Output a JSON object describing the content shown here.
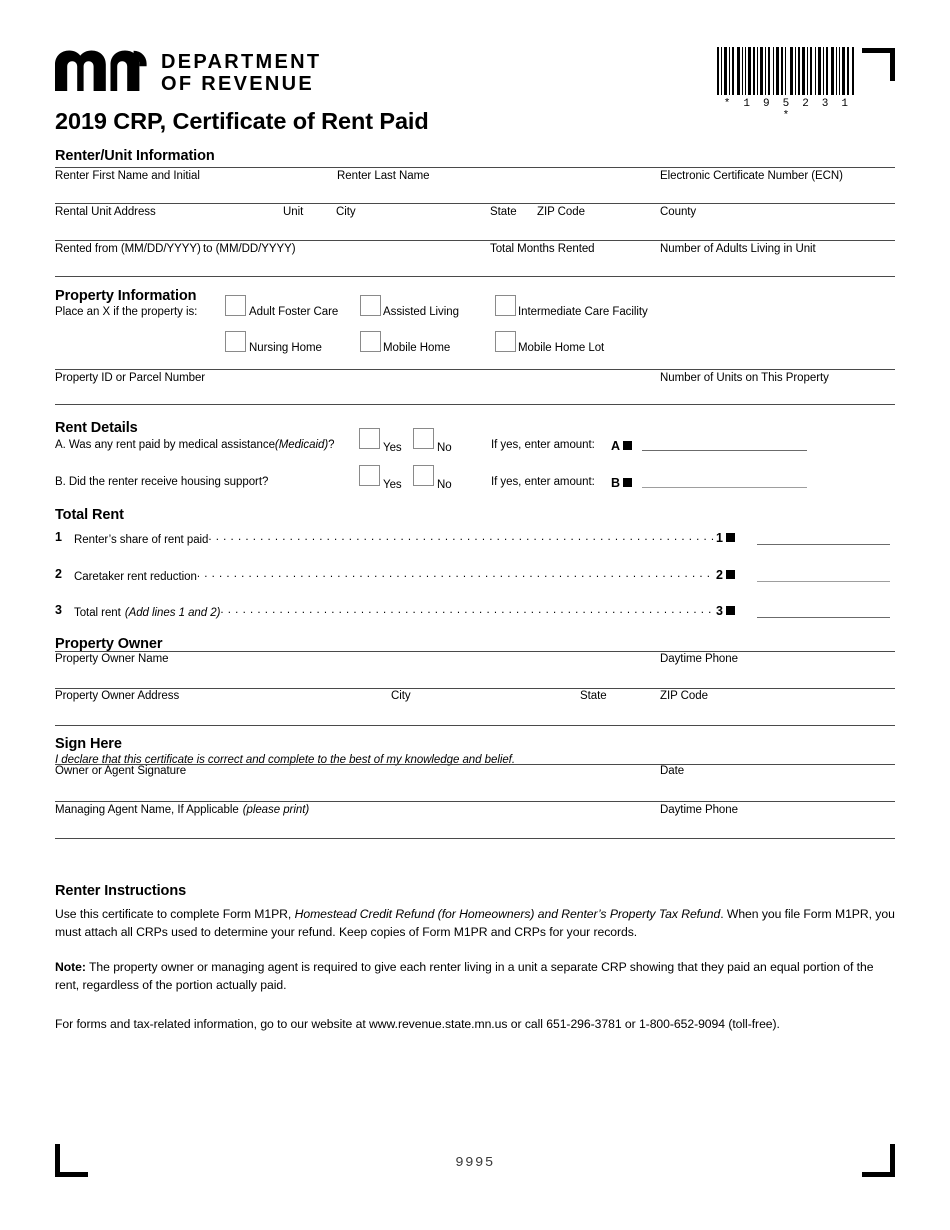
{
  "header": {
    "agency_line1": "DEPARTMENT",
    "agency_line2": "OF REVENUE",
    "logo_name": "mn",
    "form_title": "2019 CRP, Certificate of Rent Paid",
    "barcode_text": "* 1 9 5 2 3 1 *",
    "barcode_value": "195231"
  },
  "renter_unit": {
    "heading": "Renter/Unit Information",
    "fields": {
      "first_name": "Renter First Name and Initial",
      "last_name": "Renter Last Name",
      "ecn": "Electronic Certificate Number (ECN)",
      "address": "Rental Unit Address",
      "unit": "Unit",
      "city": "City",
      "state": "State",
      "zip": "ZIP Code",
      "county": "County",
      "rented_from": "Rented from (MM/DD/YYYY)",
      "rented_to": "to (MM/DD/YYYY)",
      "total_months": "Total Months Rented",
      "adults": "Number of Adults Living in Unit"
    }
  },
  "property_info": {
    "heading": "Property Information",
    "instruction": "Place an X if the property is:",
    "checkboxes": [
      "Adult Foster Care",
      "Assisted Living",
      "Intermediate Care Facility",
      "Nursing Home",
      "Mobile Home",
      "Mobile Home Lot"
    ],
    "parcel_label": "Property ID or Parcel Number",
    "units_label": "Number of Units on This Property"
  },
  "rent_details": {
    "heading": "Rent Details",
    "question_a": "A. Was any rent paid by medical assistance",
    "question_a_italic": "(Medicaid)",
    "question_a_tail": "?",
    "question_b": "B. Did the renter receive housing support?",
    "yes_label": "Yes",
    "no_label": "No",
    "amount_prompt": "If yes, enter amount:",
    "marker_a": "A",
    "marker_b": "B"
  },
  "total_rent": {
    "heading": "Total Rent",
    "lines": [
      {
        "num": "1",
        "label": "Renter’s share of rent paid",
        "italic": ""
      },
      {
        "num": "2",
        "label": "Caretaker rent reduction",
        "italic": ""
      },
      {
        "num": "3",
        "label": "Total rent",
        "italic": "(Add lines 1 and 2)"
      }
    ]
  },
  "property_owner": {
    "heading": "Property Owner",
    "owner_name": "Property Owner Name",
    "daytime_phone": "Daytime Phone",
    "owner_address": "Property Owner Address",
    "city": "City",
    "state": "State",
    "zip": "ZIP Code"
  },
  "sign_here": {
    "heading": "Sign Here",
    "declaration": "I declare that this certificate is correct and complete to the best of my knowledge and belief.",
    "signature_label": "Owner or Agent Signature",
    "date_label": "Date",
    "agent_label": "Managing Agent Name, If Applicable",
    "agent_label_italic": "(please print)",
    "agent_phone_label": "Daytime Phone"
  },
  "instructions": {
    "heading": "Renter Instructions",
    "para1_part1": "Use this certificate to complete Form M1PR, ",
    "para1_italic": "Homestead Credit Refund (for Homeowners) and Renter’s Property Tax Refund",
    "para1_part2": ". When you file Form M1PR, you must attach all CRPs used to determine your refund. Keep copies of Form M1PR and CRPs for your records.",
    "note_label": "Note:",
    "note_text": " The property owner or managing agent is required to give each renter living in a unit a separate CRP showing that they paid an equal portion of the rent, regardless of the portion actually paid.",
    "contact": "For forms and tax-related information, go to our website at www.revenue.state.mn.us or call 651-296-3781 or 1-800-652-9094 (toll-free)."
  },
  "footer": {
    "page_code": "9995"
  }
}
